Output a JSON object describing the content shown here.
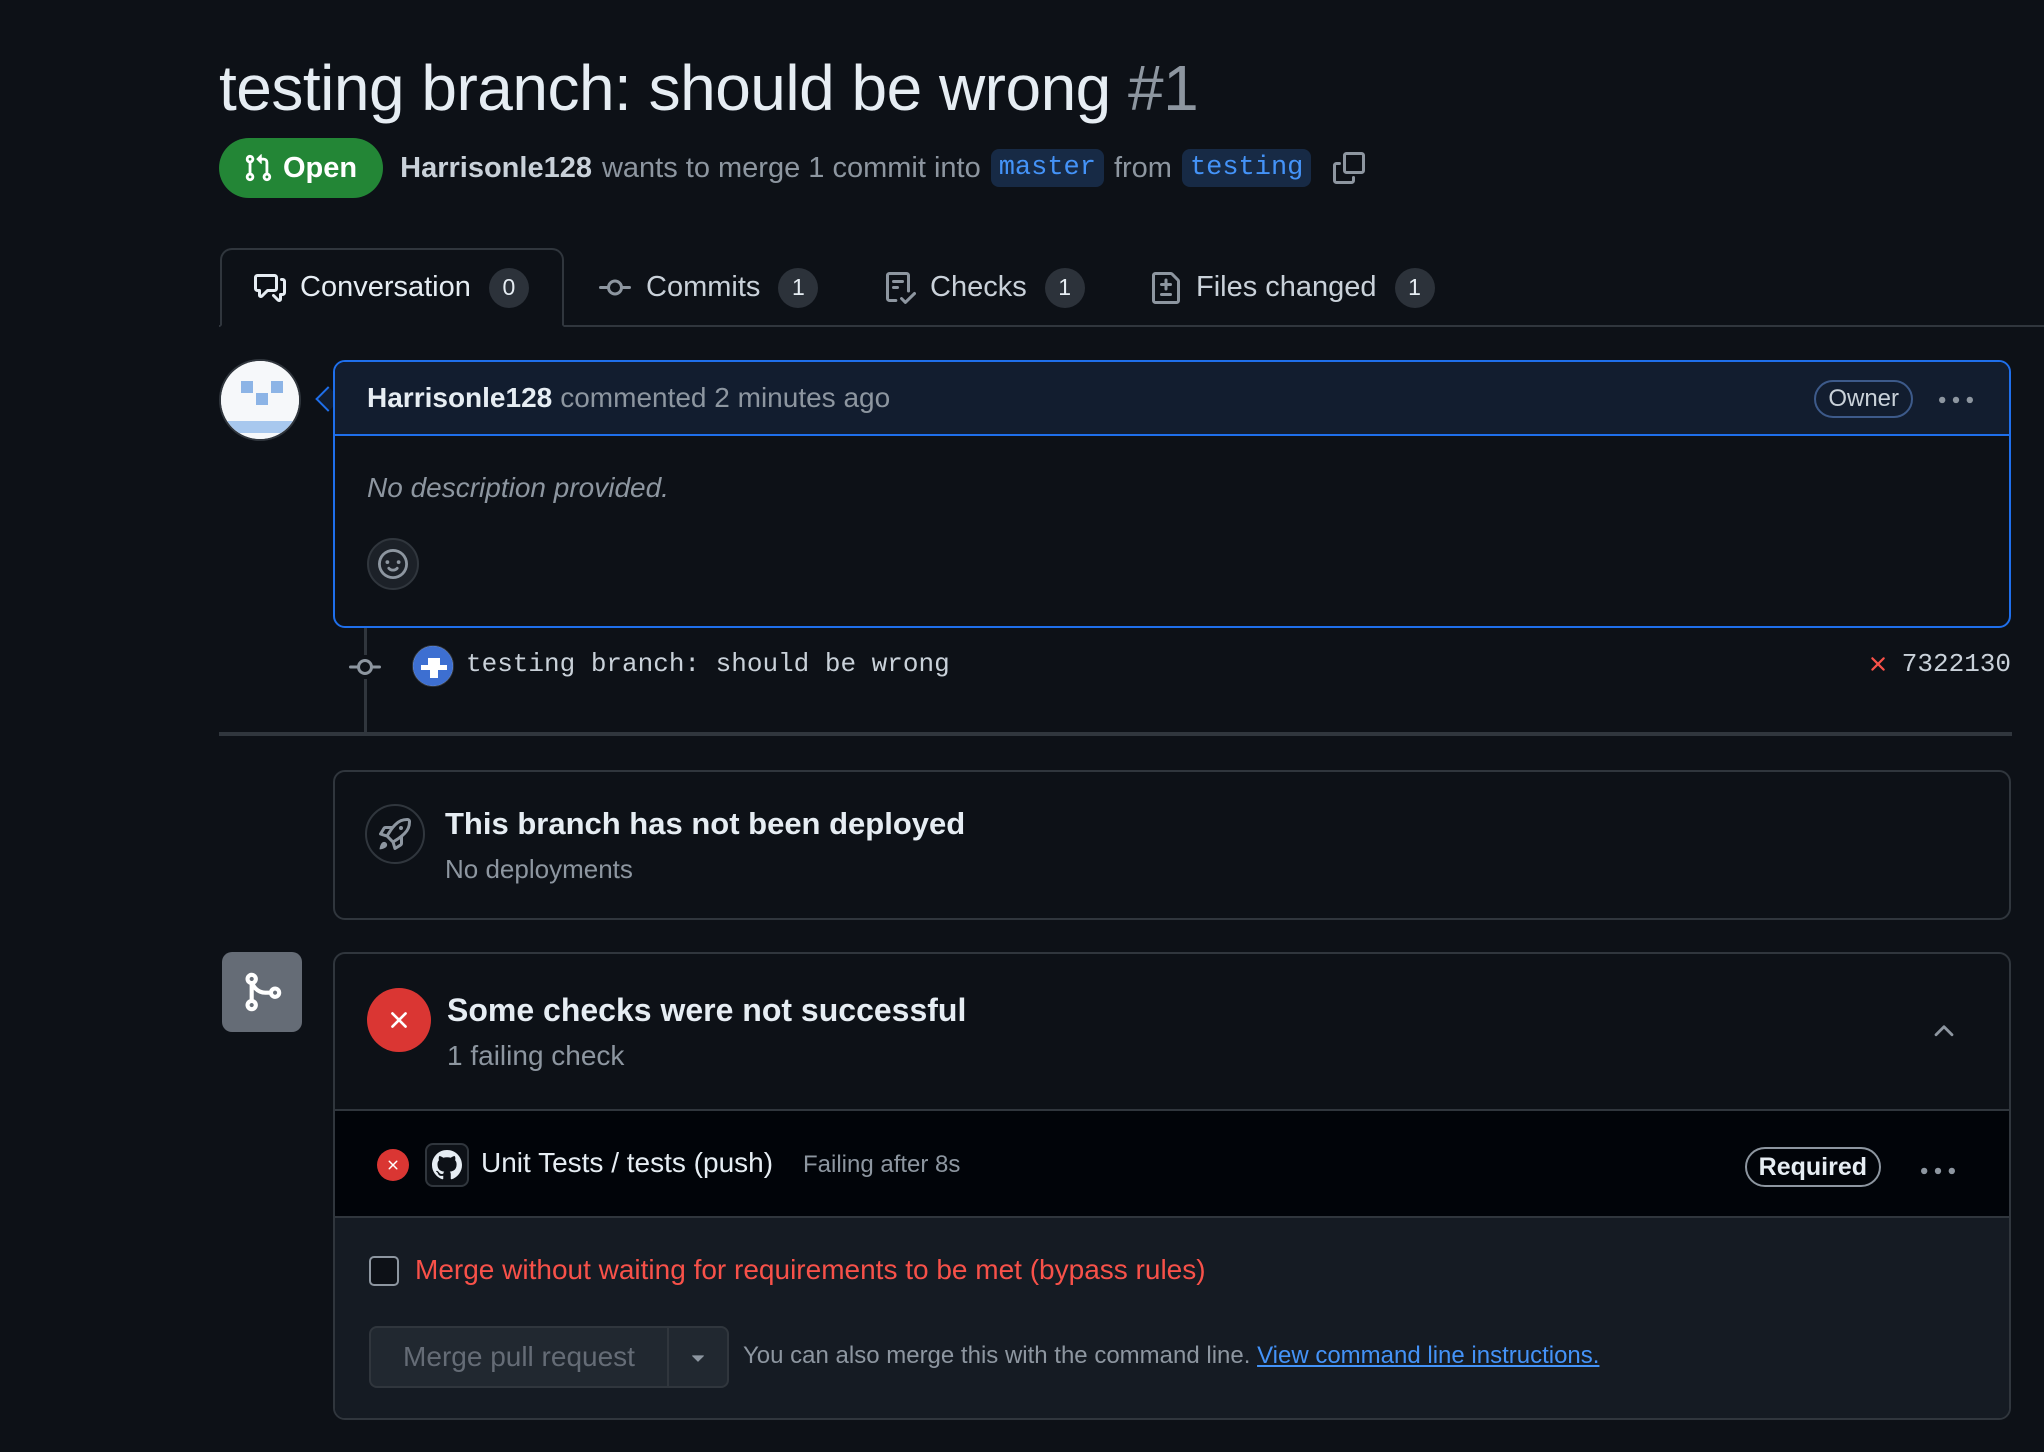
{
  "header": {
    "title": "testing branch: should be wrong",
    "number": "#1",
    "state": "Open",
    "author": "Harrisonle128",
    "merge_text": "wants to merge 1 commit into",
    "base_branch": "master",
    "from_text": "from",
    "head_branch": "testing"
  },
  "tabs": [
    {
      "label": "Conversation",
      "count": "0",
      "icon": "comment-discussion-icon"
    },
    {
      "label": "Commits",
      "count": "1",
      "icon": "git-commit-icon"
    },
    {
      "label": "Checks",
      "count": "1",
      "icon": "checklist-icon"
    },
    {
      "label": "Files changed",
      "count": "1",
      "icon": "file-diff-icon"
    }
  ],
  "comment": {
    "author": "Harrisonle128",
    "action": "commented 2 minutes ago",
    "badge": "Owner",
    "body": "No description provided."
  },
  "commit": {
    "message": "testing branch: should be wrong",
    "sha": "7322130",
    "status": "failed"
  },
  "deployment": {
    "title": "This branch has not been deployed",
    "subtitle": "No deployments"
  },
  "checks": {
    "title": "Some checks were not successful",
    "subtitle": "1 failing check",
    "items": [
      {
        "name": "Unit Tests / tests (push)",
        "status": "Failing after 8s",
        "badge": "Required"
      }
    ]
  },
  "merge": {
    "bypass_label": "Merge without waiting for requirements to be met (bypass rules)",
    "button_label": "Merge pull request",
    "cli_text": "You can also merge this with the command line.",
    "cli_link": "View command line instructions."
  },
  "colors": {
    "background": "#0d1117",
    "open_green": "#238636",
    "accent_blue": "#4493f8",
    "danger_red": "#da3633"
  }
}
